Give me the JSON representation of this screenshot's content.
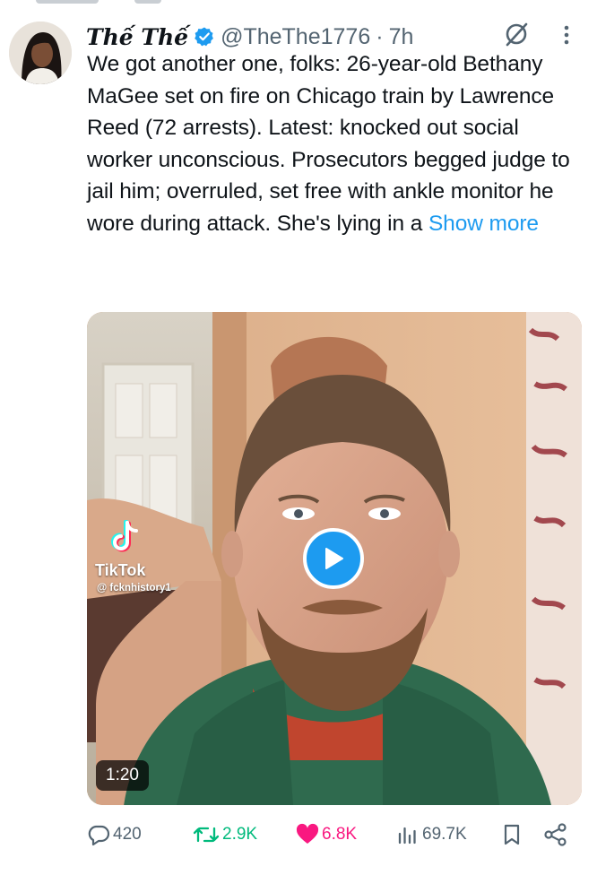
{
  "tweet": {
    "display_name": "Thế Thế",
    "handle": "@TheThe1776",
    "separator": "·",
    "time": "7h",
    "text": "We got another one, folks: 26-year-old Bethany MaGee set on fire on Chicago train by Lawrence Reed (72 arrests). Latest: knocked out social worker unconscious. Prosecutors begged judge to jail him; overruled, set free with ankle monitor he wore during attack.  She's lying in a ",
    "show_more_label": "Show more"
  },
  "media": {
    "watermark_brand": "TikTok",
    "watermark_user": "@ fcknhistory1",
    "duration": "1:20"
  },
  "actions": {
    "replies": "420",
    "reposts": "2.9K",
    "likes": "6.8K",
    "views": "69.7K"
  },
  "colors": {
    "accent": "#1d9bf0",
    "repost": "#00ba7c",
    "like": "#f91880",
    "muted": "#536471"
  },
  "icons": [
    "verified-badge-icon",
    "grok-icon",
    "more-icon",
    "play-icon",
    "tiktok-logo-icon",
    "reply-icon",
    "repost-icon",
    "like-icon",
    "views-icon",
    "bookmark-icon",
    "share-icon"
  ]
}
